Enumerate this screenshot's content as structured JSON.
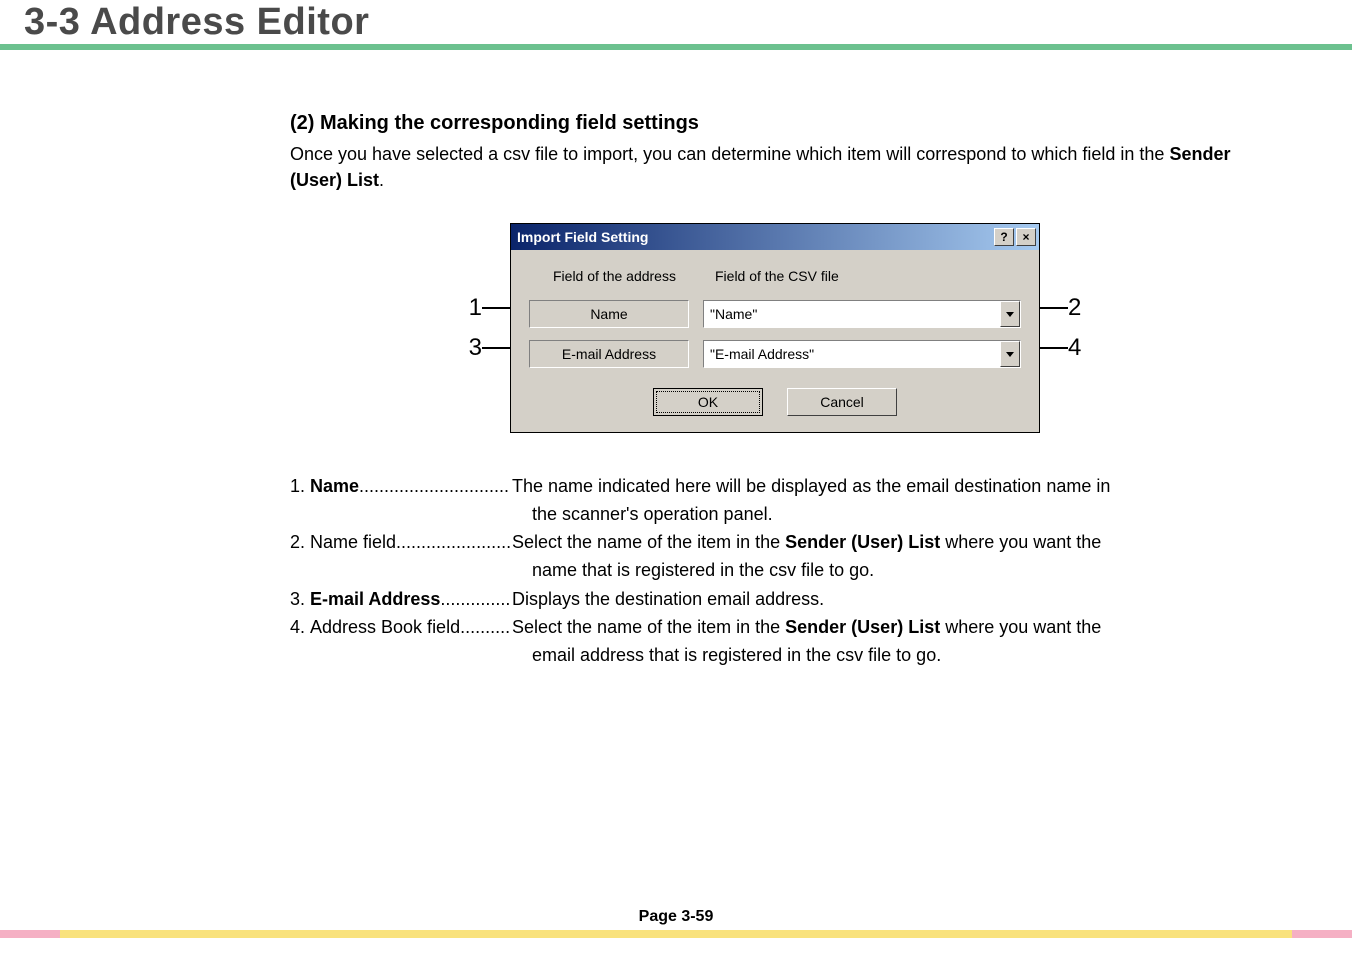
{
  "header": {
    "title": "3-3  Address Editor"
  },
  "section": {
    "subheading": "(2) Making the corresponding field settings",
    "intro_part1": "Once you have selected a csv file to import, you can determine which item will correspond to which field in the ",
    "intro_bold": "Sender (User) List",
    "intro_part2": "."
  },
  "dialog": {
    "title": "Import Field Setting",
    "help": "?",
    "close": "×",
    "header_left": "Field of the address",
    "header_right": "Field of the CSV file",
    "row1": {
      "label": "Name",
      "value": "\"Name\""
    },
    "row2": {
      "label": "E-mail Address",
      "value": "\"E-mail Address\""
    },
    "ok": "OK",
    "cancel": "Cancel"
  },
  "callouts": {
    "c1": "1",
    "c2": "2",
    "c3": "3",
    "c4": "4"
  },
  "legend": {
    "items": [
      {
        "num": "1.",
        "key_bold": true,
        "key": "Name",
        "dots": " .............................. ",
        "desc_a": "The name indicated here will be displayed as the email destination name in",
        "cont": "the scanner's operation panel."
      },
      {
        "num": "2.",
        "key_bold": false,
        "key": "Name field",
        "dots": " ....................... ",
        "desc_a": "Select the name of the item in the ",
        "desc_bold": "Sender (User) List",
        "desc_b": " where you want the",
        "cont": "name that is registered in the csv file to go."
      },
      {
        "num": "3.",
        "key_bold": true,
        "key": "E-mail Address",
        "dots": " .............. ",
        "desc_a": "Displays the destination email address."
      },
      {
        "num": "4.",
        "key_bold": false,
        "key": "Address Book field",
        "dots": " .......... ",
        "desc_a": "Select the name of the item in the ",
        "desc_bold": "Sender (User) List",
        "desc_b": " where you want the",
        "cont": "email address that is registered in the csv file to go."
      }
    ]
  },
  "footer": {
    "page": "Page 3-59"
  }
}
